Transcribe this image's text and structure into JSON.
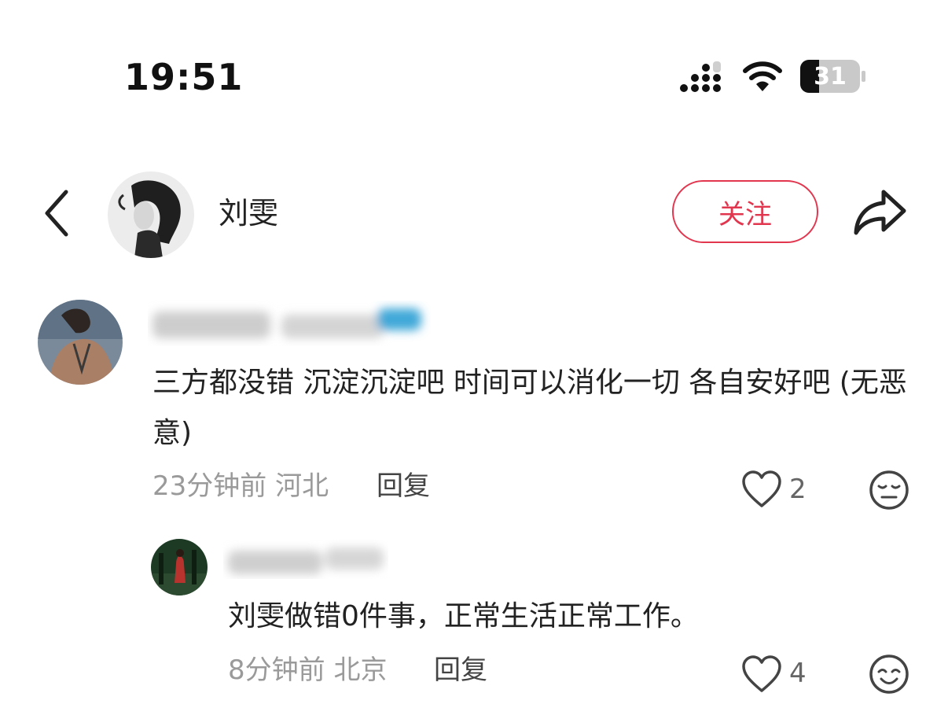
{
  "status_bar": {
    "time": "19:51",
    "battery_level": "31",
    "icons": [
      "signal-icon",
      "wifi-icon",
      "battery-icon"
    ]
  },
  "header": {
    "username": "刘雯",
    "follow_label": "关注",
    "icons": [
      "back-chevron-icon",
      "share-icon"
    ]
  },
  "comment": {
    "text": "三方都没错  沉淀沉淀吧  时间可以消化一切  各自安好吧 (无恶意)",
    "time": "23分钟前",
    "location": "河北",
    "reply_label": "回复",
    "likes": "2"
  },
  "reply": {
    "text": "刘雯做错0件事，正常生活正常工作。",
    "time": "8分钟前",
    "location": "北京",
    "reply_label": "回复",
    "likes": "4"
  },
  "colors": {
    "accent": "#e2364f",
    "meta_text": "#9a9a9a",
    "body_text": "#222222"
  }
}
